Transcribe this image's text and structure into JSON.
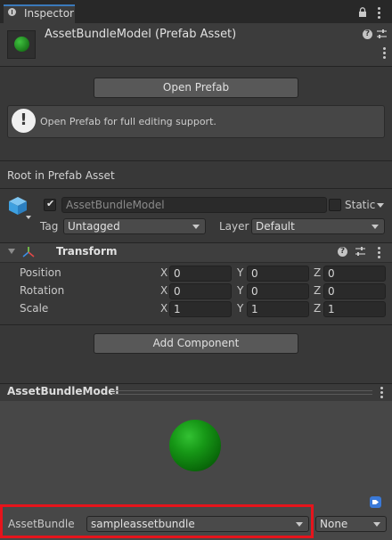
{
  "tab": {
    "label": "Inspector"
  },
  "header": {
    "title": "AssetBundleModel (Prefab Asset)"
  },
  "open_prefab": {
    "label": "Open Prefab"
  },
  "help": {
    "text": "Open Prefab for full editing support."
  },
  "root_label": "Root in Prefab Asset",
  "gameobject": {
    "name": "AssetBundleModel",
    "active": true,
    "static_label": "Static",
    "static": false,
    "tag_label": "Tag",
    "tag_value": "Untagged",
    "layer_label": "Layer",
    "layer_value": "Default"
  },
  "transform": {
    "title": "Transform",
    "rows": [
      {
        "label": "Position",
        "x": "0",
        "y": "0",
        "z": "0"
      },
      {
        "label": "Rotation",
        "x": "0",
        "y": "0",
        "z": "0"
      },
      {
        "label": "Scale",
        "x": "1",
        "y": "1",
        "z": "1"
      }
    ],
    "axis": {
      "x": "X",
      "y": "Y",
      "z": "Z"
    }
  },
  "add_component": {
    "label": "Add Component"
  },
  "preview": {
    "title": "AssetBundleModel"
  },
  "asset_bundle": {
    "label": "AssetBundle",
    "name_value": "sampleassetbundle",
    "variant_value": "None"
  },
  "colors": {
    "accent": "#3a79bb",
    "highlight": "#e6141c",
    "sphere": "#169716"
  },
  "icons": [
    "info-icon",
    "lock-icon",
    "menu-icon",
    "help-icon",
    "presets-icon",
    "transform-icon",
    "gameobject-cube-icon",
    "tag-icon",
    "warning-icon"
  ]
}
